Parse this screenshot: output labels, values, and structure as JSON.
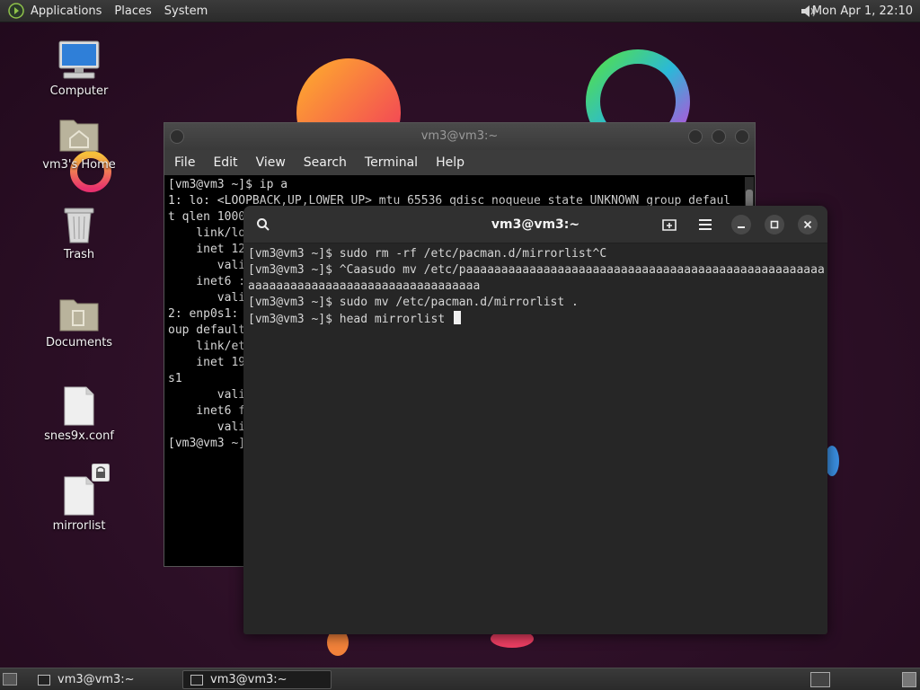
{
  "top_panel": {
    "menus": [
      "Applications",
      "Places",
      "System"
    ],
    "clock": "Mon Apr  1, 22:10"
  },
  "desktop_icons": [
    {
      "label": "Computer",
      "icon": "computer-icon"
    },
    {
      "label": "vm3's Home",
      "icon": "home-folder-icon"
    },
    {
      "label": "Trash",
      "icon": "trash-icon"
    },
    {
      "label": "Documents",
      "icon": "folder-icon"
    },
    {
      "label": "snes9x.conf",
      "icon": "file-icon"
    },
    {
      "label": "mirrorlist",
      "icon": "locked-file-icon"
    }
  ],
  "back_terminal": {
    "title": "vm3@vm3:~",
    "menu": [
      "File",
      "Edit",
      "View",
      "Search",
      "Terminal",
      "Help"
    ],
    "lines": [
      "[vm3@vm3 ~]$ ip a",
      "1: lo: <LOOPBACK,UP,LOWER_UP> mtu 65536 qdisc noqueue state UNKNOWN group defaul",
      "t qlen 1000",
      "    link/lo",
      "    inet 12",
      "       vali",
      "    inet6 :",
      "       vali",
      "2: enp0s1:",
      "oup default",
      "    link/et",
      "    inet 19",
      "s1",
      "       vali",
      "    inet6 f",
      "       vali",
      "[vm3@vm3 ~]"
    ]
  },
  "front_terminal": {
    "title": "vm3@vm3:~",
    "lines": [
      "[vm3@vm3 ~]$ sudo rm -rf /etc/pacman.d/mirrorlist^C",
      "[vm3@vm3 ~]$ ^Caasudo mv /etc/paaaaaaaaaaaaaaaaaaaaaaaaaaaaaaaaaaaaaaaaaaaaaaaaaaa",
      "aaaaaaaaaaaaaaaaaaaaaaaaaaaaaaaaa",
      "[vm3@vm3 ~]$ sudo mv /etc/pacman.d/mirrorlist .",
      "[vm3@vm3 ~]$ head mirrorlist "
    ]
  },
  "taskbar": {
    "tasks": [
      "vm3@vm3:~",
      "vm3@vm3:~"
    ]
  }
}
